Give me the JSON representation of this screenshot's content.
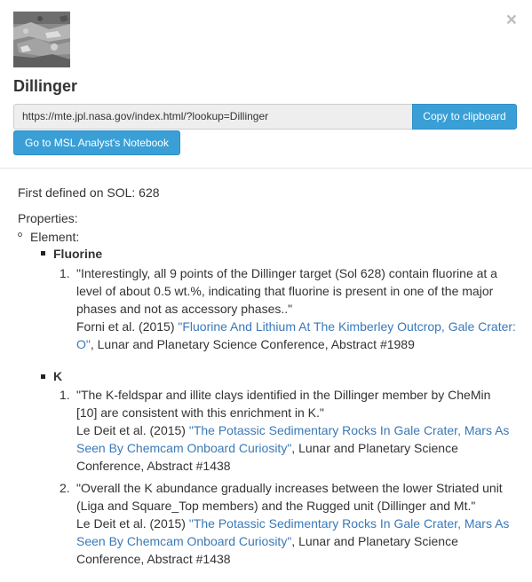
{
  "modal": {
    "close_glyph": "×",
    "title": "Dillinger",
    "url_value": "https://mte.jpl.nasa.gov/index.html/?lookup=Dillinger",
    "copy_button": "Copy to clipboard",
    "notebook_button": "Go to MSL Analyst's Notebook",
    "thumbnail_alt": "Dillinger target image"
  },
  "details": {
    "first_defined": "First defined on SOL: 628",
    "properties_label": "Properties:",
    "element_label": "Element:",
    "elements": [
      {
        "name": "Fluorine",
        "entries": [
          {
            "number": "1.",
            "quote_lines": [
              "\"Interestingly, all 9 points of the Dillinger target (Sol 628) contain fluorine at a",
              "level of about 0.5 wt.%, indicating that fluorine is present in one of the major",
              "phases and not as accessory phases..\""
            ],
            "authors": "Forni et al. (2015) ",
            "ref_title_lines": [
              "\"Fluorine And Lithium At The Kimberley Outcrop, Gale Crater:",
              "O\""
            ],
            "venue_first": "",
            "venue_rest": ", Lunar and Planetary Science Conference, Abstract #1989"
          }
        ]
      },
      {
        "name": "K",
        "entries": [
          {
            "number": "1.",
            "quote_lines": [
              "\"The K-feldspar and illite clays identified in the Dillinger member by CheMin",
              "[10] are consistent with this enrichment in K.\""
            ],
            "authors": "Le Deit et al. (2015) ",
            "ref_title_lines": [
              "\"The Potassic Sedimentary Rocks In Gale Crater, Mars As",
              "Seen By Chemcam Onboard Curiosity\""
            ],
            "venue_first": ", Lunar and Planetary Science",
            "venue_rest": "Conference, Abstract #1438"
          },
          {
            "number": "2.",
            "quote_lines": [
              "\"Overall the K abundance gradually increases between the lower Striated unit",
              "(Liga and Square_Top members) and the Rugged unit (Dillinger and Mt.\""
            ],
            "authors": "Le Deit et al. (2015) ",
            "ref_title_lines": [
              "\"The Potassic Sedimentary Rocks In Gale Crater, Mars As",
              "Seen By Chemcam Onboard Curiosity\""
            ],
            "venue_first": ", Lunar and Planetary Science",
            "venue_rest": "Conference, Abstract #1438"
          }
        ]
      }
    ]
  },
  "colors": {
    "accent": "#3a9fd6",
    "link": "#3a79b8",
    "text": "#333333"
  }
}
